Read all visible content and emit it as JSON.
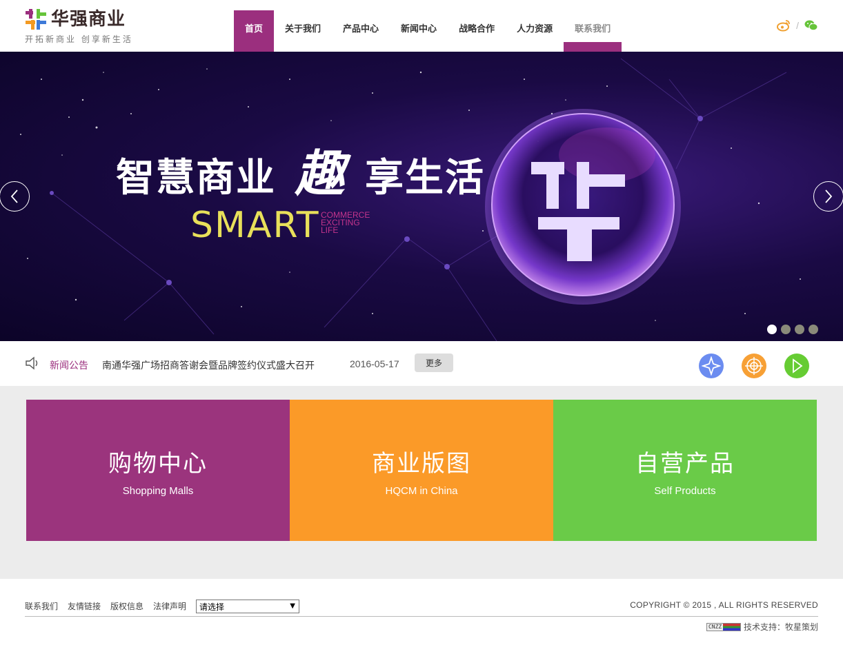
{
  "header": {
    "logo_title": "华强商业",
    "logo_slogan": "开拓新商业 创享新生活",
    "nav": [
      {
        "label": "首页"
      },
      {
        "label": "关于我们"
      },
      {
        "label": "产品中心"
      },
      {
        "label": "新闻中心"
      },
      {
        "label": "战略合作"
      },
      {
        "label": "人力资源"
      },
      {
        "label": "联系我们"
      }
    ],
    "social_separator": "/"
  },
  "banner": {
    "headline_part1": "智慧商业",
    "headline_char": "趣",
    "headline_part2": "享生活",
    "smart": "SMART",
    "smart_sub": [
      "COMMERCE",
      "EXCITING",
      "LIFE"
    ],
    "logo_glyph": "华",
    "slide_count": 4,
    "active_slide": 1
  },
  "news": {
    "label": "新闻公告",
    "title": "南通华强广场招商答谢会暨品牌签约仪式盛大召开",
    "date": "2016-05-17",
    "more": "更多"
  },
  "panels": [
    {
      "cn": "购物中心",
      "en": "Shopping Malls",
      "color": "#9b347d"
    },
    {
      "cn": "商业版图",
      "en": "HQCM in China",
      "color": "#fb9a28"
    },
    {
      "cn": "自营产品",
      "en": "Self Products",
      "color": "#6acb48"
    }
  ],
  "quick_buttons": [
    {
      "icon": "compass-icon",
      "color": "#6b8cf0"
    },
    {
      "icon": "target-icon",
      "color": "#f7a035"
    },
    {
      "icon": "play-icon",
      "color": "#66cc33"
    }
  ],
  "footer": {
    "links": [
      "联系我们",
      "友情链接",
      "版权信息",
      "法律声明"
    ],
    "select_value": "请选择",
    "copyright": "COPYRIGHT © 2015 , ALL RIGHTS RESERVED",
    "cnzz": "CNZZ",
    "tech_support": "技术支持：牧星策划"
  }
}
